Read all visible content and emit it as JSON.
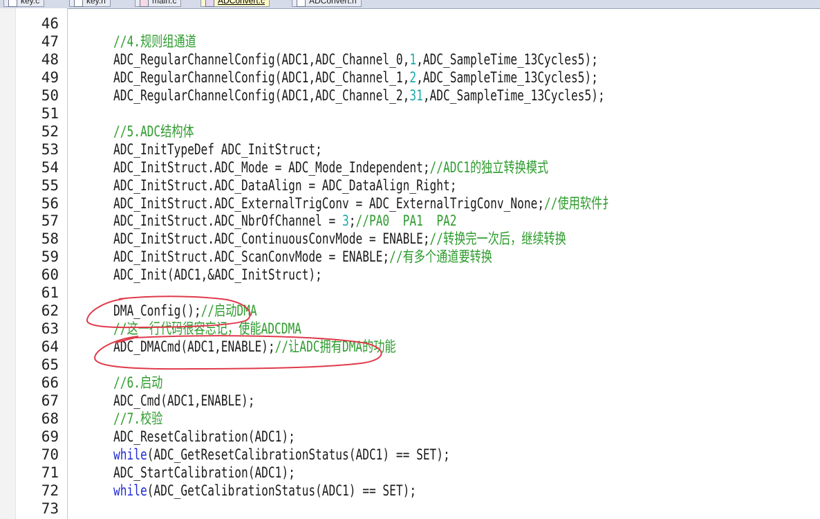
{
  "tabs": [
    {
      "label": "key.c",
      "active": false
    },
    {
      "label": "key.h",
      "active": false
    },
    {
      "label": "main.c",
      "active": false
    },
    {
      "label": "ADConvert.c",
      "active": true
    },
    {
      "label": "ADConvert.h",
      "active": false
    }
  ],
  "lines": [
    {
      "n": "46",
      "segs": []
    },
    {
      "n": "47",
      "segs": [
        {
          "t": "//4.规则组通道",
          "c": "cmt"
        }
      ]
    },
    {
      "n": "48",
      "segs": [
        {
          "t": "ADC_RegularChannelConfig(ADC1,ADC_Channel_0,",
          "c": ""
        },
        {
          "t": "1",
          "c": "num"
        },
        {
          "t": ",ADC_SampleTime_13Cycles5);",
          "c": ""
        }
      ]
    },
    {
      "n": "49",
      "segs": [
        {
          "t": "ADC_RegularChannelConfig(ADC1,ADC_Channel_1,",
          "c": ""
        },
        {
          "t": "2",
          "c": "num"
        },
        {
          "t": ",ADC_SampleTime_13Cycles5);",
          "c": ""
        }
      ]
    },
    {
      "n": "50",
      "segs": [
        {
          "t": "ADC_RegularChannelConfig(ADC1,ADC_Channel_2,",
          "c": ""
        },
        {
          "t": "31",
          "c": "num"
        },
        {
          "t": ",ADC_SampleTime_13Cycles5);",
          "c": ""
        }
      ]
    },
    {
      "n": "51",
      "segs": []
    },
    {
      "n": "52",
      "segs": [
        {
          "t": "//5.ADC结构体",
          "c": "cmt"
        }
      ]
    },
    {
      "n": "53",
      "segs": [
        {
          "t": "ADC_InitTypeDef ADC_InitStruct;",
          "c": ""
        }
      ]
    },
    {
      "n": "54",
      "segs": [
        {
          "t": "ADC_InitStruct.ADC_Mode = ADC_Mode_Independent;",
          "c": ""
        },
        {
          "t": "//ADC1的独立转换模式",
          "c": "cmt"
        }
      ]
    },
    {
      "n": "55",
      "segs": [
        {
          "t": "ADC_InitStruct.ADC_DataAlign = ADC_DataAlign_Right;",
          "c": ""
        }
      ]
    },
    {
      "n": "56",
      "segs": [
        {
          "t": "ADC_InitStruct.ADC_ExternalTrigConv = ADC_ExternalTrigConv_None;",
          "c": ""
        },
        {
          "t": "//使用软件扌",
          "c": "cmt"
        }
      ]
    },
    {
      "n": "57",
      "segs": [
        {
          "t": "ADC_InitStruct.ADC_NbrOfChannel = ",
          "c": ""
        },
        {
          "t": "3",
          "c": "num"
        },
        {
          "t": ";",
          "c": ""
        },
        {
          "t": "//PA0  PA1  PA2",
          "c": "cmt"
        }
      ]
    },
    {
      "n": "58",
      "segs": [
        {
          "t": "ADC_InitStruct.ADC_ContinuousConvMode = ENABLE;",
          "c": ""
        },
        {
          "t": "//转换完一次后，继续转换",
          "c": "cmt"
        }
      ]
    },
    {
      "n": "59",
      "segs": [
        {
          "t": "ADC_InitStruct.ADC_ScanConvMode = ENABLE;",
          "c": ""
        },
        {
          "t": "//有多个通道要转换",
          "c": "cmt"
        }
      ]
    },
    {
      "n": "60",
      "segs": [
        {
          "t": "ADC_Init(ADC1,&ADC_InitStruct);",
          "c": ""
        }
      ]
    },
    {
      "n": "61",
      "segs": []
    },
    {
      "n": "62",
      "segs": [
        {
          "t": "DMA_Config();",
          "c": ""
        },
        {
          "t": "//启动DMA",
          "c": "cmt"
        }
      ]
    },
    {
      "n": "63",
      "segs": [
        {
          "t": "//这一行代码很容忘记，使能ADCDMA",
          "c": "cmt"
        }
      ]
    },
    {
      "n": "64",
      "segs": [
        {
          "t": "ADC_DMACmd(ADC1,ENABLE);",
          "c": ""
        },
        {
          "t": "//让ADC拥有DMA的功能",
          "c": "cmt"
        }
      ]
    },
    {
      "n": "65",
      "segs": []
    },
    {
      "n": "66",
      "segs": [
        {
          "t": "//6.启动",
          "c": "cmt"
        }
      ]
    },
    {
      "n": "67",
      "segs": [
        {
          "t": "ADC_Cmd(ADC1,ENABLE);",
          "c": ""
        }
      ]
    },
    {
      "n": "68",
      "segs": [
        {
          "t": "//7.校验",
          "c": "cmt"
        }
      ]
    },
    {
      "n": "69",
      "segs": [
        {
          "t": "ADC_ResetCalibration(ADC1);",
          "c": ""
        }
      ]
    },
    {
      "n": "70",
      "segs": [
        {
          "t": "while",
          "c": "kw"
        },
        {
          "t": "(ADC_GetResetCalibrationStatus(ADC1) == SET);",
          "c": ""
        }
      ]
    },
    {
      "n": "71",
      "segs": [
        {
          "t": "ADC_StartCalibration(ADC1);",
          "c": ""
        }
      ]
    },
    {
      "n": "72",
      "segs": [
        {
          "t": "while",
          "c": "kw"
        },
        {
          "t": "(ADC_GetCalibrationStatus(ADC1) == SET);",
          "c": ""
        }
      ]
    },
    {
      "n": "73",
      "segs": []
    }
  ],
  "colors": {
    "keyword": "#1f2bd6",
    "number": "#1aa9a9",
    "comment": "#2e9c2e",
    "annotation": "#e0394a"
  }
}
